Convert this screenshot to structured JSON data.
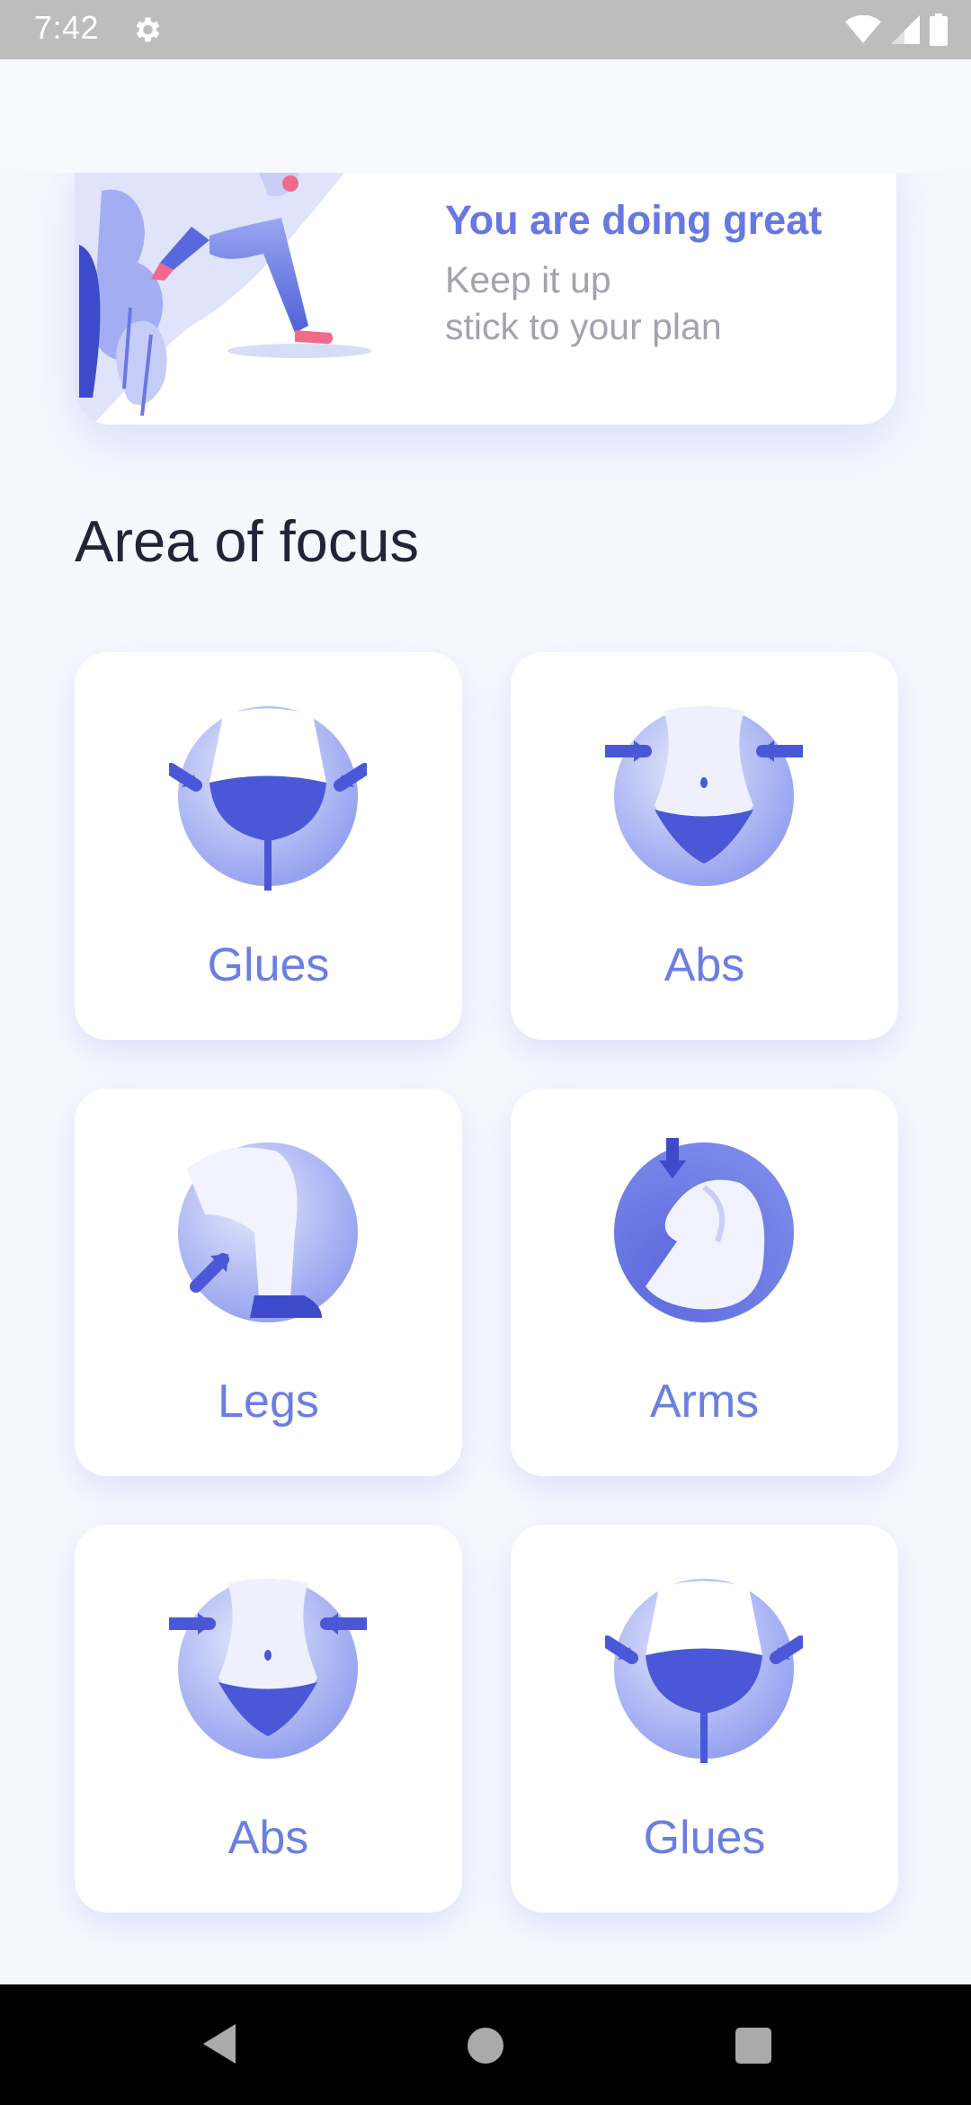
{
  "status_bar": {
    "time": "7:42",
    "icons": [
      "settings-gear-icon",
      "wifi-icon",
      "cellular-signal-icon",
      "battery-icon"
    ]
  },
  "hero": {
    "title": "You are doing great",
    "subtitle_line1": "Keep it up",
    "subtitle_line2": "stick to your plan"
  },
  "section": {
    "title": "Area of focus"
  },
  "focus_tiles": [
    {
      "label": "Glues",
      "icon": "glutes-icon"
    },
    {
      "label": "Abs",
      "icon": "abs-icon"
    },
    {
      "label": "Legs",
      "icon": "legs-icon"
    },
    {
      "label": "Arms",
      "icon": "arms-icon"
    },
    {
      "label": "Abs",
      "icon": "abs-icon"
    },
    {
      "label": "Glues",
      "icon": "glutes-icon"
    }
  ],
  "nav_bar": {
    "icons": [
      "back-icon",
      "home-icon",
      "recents-icon"
    ]
  },
  "colors": {
    "accent": "#6777e3",
    "label": "#6b7ee3",
    "heading": "#22243a",
    "subtext": "#a3a3ae",
    "background": "#f7f8fe"
  }
}
